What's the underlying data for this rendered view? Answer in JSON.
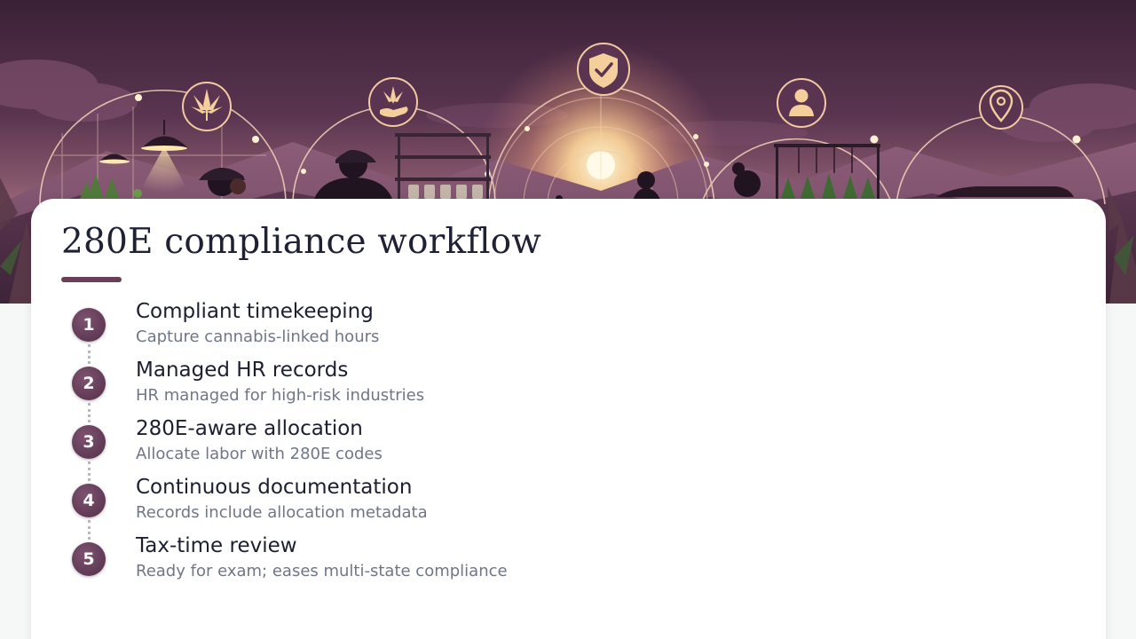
{
  "hero": {
    "icons": [
      "cannabis-leaf-icon",
      "hand-holding-leaf-icon",
      "shield-check-icon",
      "person-icon",
      "location-pin-icon"
    ]
  },
  "card": {
    "title": "280E compliance workflow",
    "accent_color": "#6b3e58"
  },
  "steps": [
    {
      "number": "1",
      "title": "Compliant timekeeping",
      "description": "Capture cannabis-linked hours"
    },
    {
      "number": "2",
      "title": "Managed HR records",
      "description": "HR managed for high-risk industries"
    },
    {
      "number": "3",
      "title": "280E-aware allocation",
      "description": "Allocate labor with 280E codes"
    },
    {
      "number": "4",
      "title": "Continuous documentation",
      "description": "Records include allocation metadata"
    },
    {
      "number": "5",
      "title": "Tax-time review",
      "description": "Ready for exam; eases multi-state compliance"
    }
  ]
}
